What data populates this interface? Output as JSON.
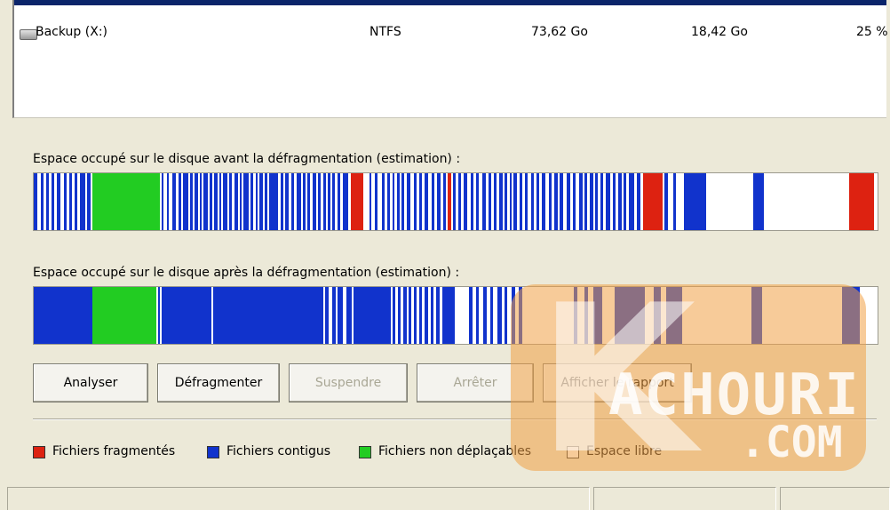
{
  "volumes": [
    {
      "name": "",
      "fs": "",
      "capacity": "",
      "free": "",
      "pct": "",
      "selected": true
    },
    {
      "name": "Backup (X:)",
      "fs": "NTFS",
      "capacity": "73,62 Go",
      "free": "18,42 Go",
      "pct": "25 %",
      "selected": false
    }
  ],
  "before": {
    "label": "Espace occupé sur le disque avant la défragmentation (estimation) :"
  },
  "after": {
    "label": "Espace occupé sur le disque après la défragmentation (estimation) :"
  },
  "buttons": {
    "analyze": "Analyser",
    "defragment": "Défragmenter",
    "pause": "Suspendre",
    "stop": "Arrêter",
    "report": "Afficher le rapport"
  },
  "legend": {
    "fragmented": {
      "label": "Fichiers fragmentés",
      "color": "#dd2211"
    },
    "contiguous": {
      "label": "Fichiers contigus",
      "color": "#1133cc"
    },
    "unmovable": {
      "label": "Fichiers non déplaçables",
      "color": "#22cc22"
    },
    "free": {
      "label": "Espace libre",
      "color": "#ffffff"
    }
  },
  "watermark": {
    "text": "ACHOURI",
    "sub": ".COM"
  }
}
